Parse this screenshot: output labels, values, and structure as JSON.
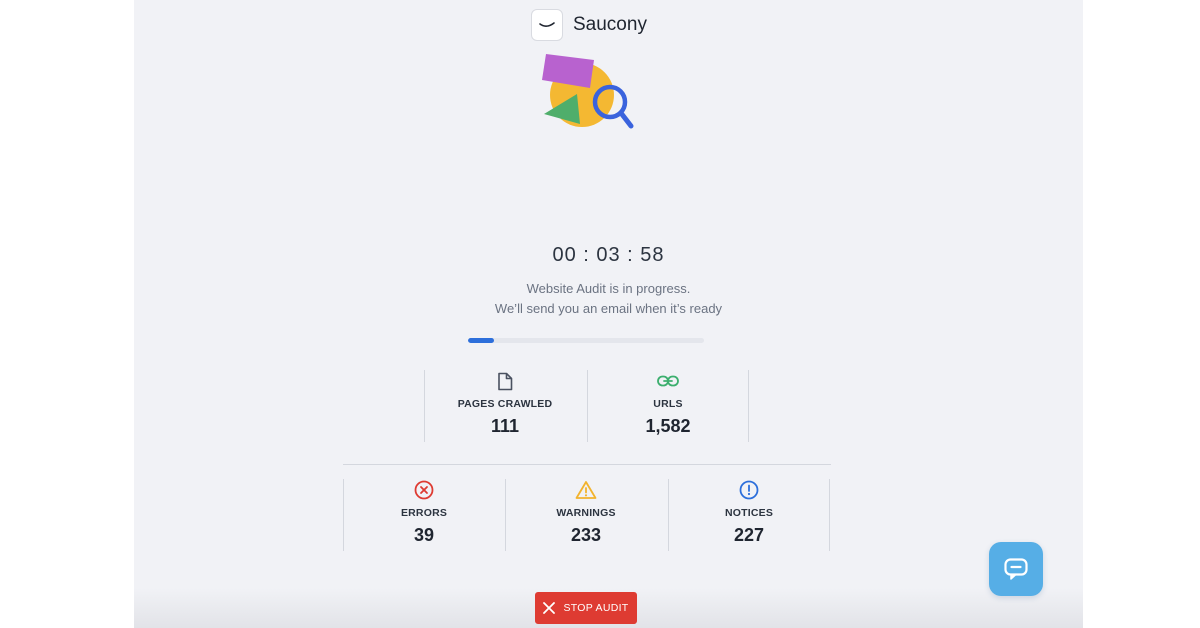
{
  "brand": {
    "name": "Saucony",
    "logo_icon": "saucony-logo-icon"
  },
  "illustration": {
    "icon": "audit-illustration-icon"
  },
  "timer": {
    "text": "00 : 03 : 58"
  },
  "status": {
    "line1": "Website Audit is in progress.",
    "line2": "We’ll send you an email when it’s ready"
  },
  "progress": {
    "fraction": 0.11,
    "color": "#2d6fdb"
  },
  "stats_top": [
    {
      "icon": "document-icon",
      "label": "PAGES CRAWLED",
      "value": "111"
    },
    {
      "icon": "link-icon",
      "label": "URLS",
      "value": "1,582"
    }
  ],
  "stats_bottom": [
    {
      "icon": "error-icon",
      "label": "ERRORS",
      "value": "39",
      "color": "#de3b32"
    },
    {
      "icon": "warning-icon",
      "label": "WARNINGS",
      "value": "233",
      "color": "#f2b32e"
    },
    {
      "icon": "notice-icon",
      "label": "NOTICES",
      "value": "227",
      "color": "#2d6fdb"
    }
  ],
  "stop_button": {
    "label": "STOP AUDIT",
    "icon": "close-icon"
  },
  "chat_button": {
    "icon": "chat-icon"
  },
  "colors": {
    "panel_bg": "#f1f2f6",
    "accent_blue": "#2d6fdb",
    "danger_red": "#de3b32",
    "link_green": "#3caf6e",
    "chat_blue": "#56aee6"
  }
}
